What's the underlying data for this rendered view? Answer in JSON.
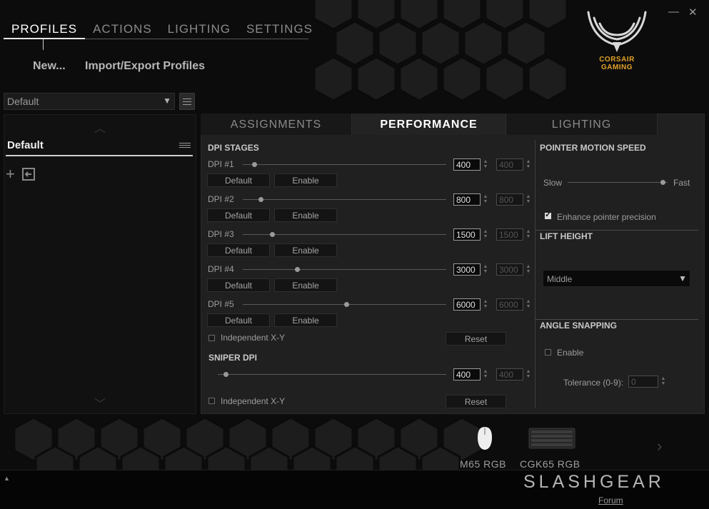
{
  "window": {
    "minimize_glyph": "—",
    "close_glyph": "✕"
  },
  "nav": {
    "tabs": [
      "PROFILES",
      "ACTIONS",
      "LIGHTING",
      "SETTINGS"
    ],
    "active": "PROFILES"
  },
  "profile_actions": {
    "new_label": "New...",
    "import_export_label": "Import/Export Profiles"
  },
  "logo": {
    "line1": "CORSAIR",
    "line2": "GAMING",
    "color": "#e2a229"
  },
  "profile_select": {
    "value": "Default"
  },
  "profile_list": {
    "items": [
      "Default"
    ],
    "add_icon": "plus-icon",
    "import_icon": "import-icon"
  },
  "content_tabs": {
    "tabs": [
      "ASSIGNMENTS",
      "PERFORMANCE",
      "LIGHTING"
    ],
    "active": "PERFORMANCE"
  },
  "dpi": {
    "section_title": "DPI STAGES",
    "stages": [
      {
        "label": "DPI #1",
        "value": "400",
        "y_value": "400"
      },
      {
        "label": "DPI #2",
        "value": "800",
        "y_value": "800"
      },
      {
        "label": "DPI #3",
        "value": "1500",
        "y_value": "1500"
      },
      {
        "label": "DPI #4",
        "value": "3000",
        "y_value": "3000"
      },
      {
        "label": "DPI #5",
        "value": "6000",
        "y_value": "6000"
      }
    ],
    "default_label": "Default",
    "enable_label": "Enable",
    "independent_label": "Independent X-Y",
    "reset_label": "Reset"
  },
  "sniper": {
    "section_title": "SNIPER DPI",
    "value": "400",
    "y_value": "400",
    "independent_label": "Independent X-Y",
    "reset_label": "Reset"
  },
  "pointer": {
    "section_title": "POINTER MOTION SPEED",
    "slow_label": "Slow",
    "fast_label": "Fast",
    "precision_label": "Enhance pointer precision",
    "precision_checked": true,
    "speed_fraction": 0.95
  },
  "lift": {
    "section_title": "LIFT HEIGHT",
    "value": "Middle"
  },
  "angle": {
    "section_title": "ANGLE SNAPPING",
    "enable_label": "Enable",
    "tolerance_label": "Tolerance (0-9):",
    "tolerance_value": "0"
  },
  "devices": [
    {
      "name": "M65 RGB",
      "icon": "mouse-icon"
    },
    {
      "name": "CGK65 RGB",
      "icon": "keyboard-icon"
    }
  ],
  "footer": {
    "up_glyph": "▲",
    "forum_label": "Forum",
    "watermark": "SLASHGEAR"
  },
  "colors": {
    "accent_gold": "#e2a229",
    "panel": "#202020",
    "background": "#0c0c0c"
  }
}
